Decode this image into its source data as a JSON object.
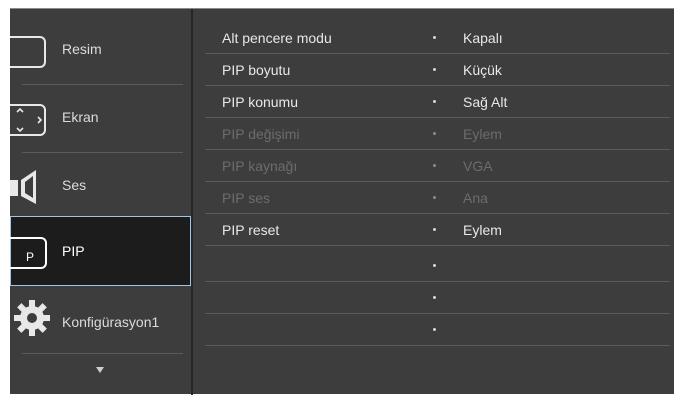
{
  "sidebar": {
    "items": [
      {
        "label": "Resim",
        "icon": "picture-icon",
        "selected": false
      },
      {
        "label": "Ekran",
        "icon": "screen-icon",
        "selected": false
      },
      {
        "label": "Ses",
        "icon": "speaker-icon",
        "selected": false
      },
      {
        "label": "PIP",
        "icon": "pip-icon",
        "icon_text": "P",
        "selected": true
      },
      {
        "label": "Konfigürasyon1",
        "icon": "gear-icon",
        "selected": false
      }
    ],
    "more_indicator": "chevron-down-icon"
  },
  "panel": {
    "rows": [
      {
        "label": "Alt pencere modu",
        "value": "Kapalı",
        "enabled": true
      },
      {
        "label": "PIP boyutu",
        "value": "Küçük",
        "enabled": true
      },
      {
        "label": "PIP konumu",
        "value": "Sağ Alt",
        "enabled": true
      },
      {
        "label": "PIP değişimi",
        "value": "Eylem",
        "enabled": false
      },
      {
        "label": "PIP kaynağı",
        "value": "VGA",
        "enabled": false
      },
      {
        "label": "PIP ses",
        "value": "Ana",
        "enabled": false
      },
      {
        "label": "PIP reset",
        "value": "Eylem",
        "enabled": true
      },
      {
        "label": "",
        "value": "",
        "enabled": true
      },
      {
        "label": "",
        "value": "",
        "enabled": true
      },
      {
        "label": "",
        "value": "",
        "enabled": true
      }
    ]
  },
  "colors": {
    "background": "#3d3d3d",
    "selected_bg": "#1c1c1c",
    "selected_border": "#9ec6e6",
    "text": "#e8e8e8",
    "disabled_text": "#6c6c6c"
  }
}
